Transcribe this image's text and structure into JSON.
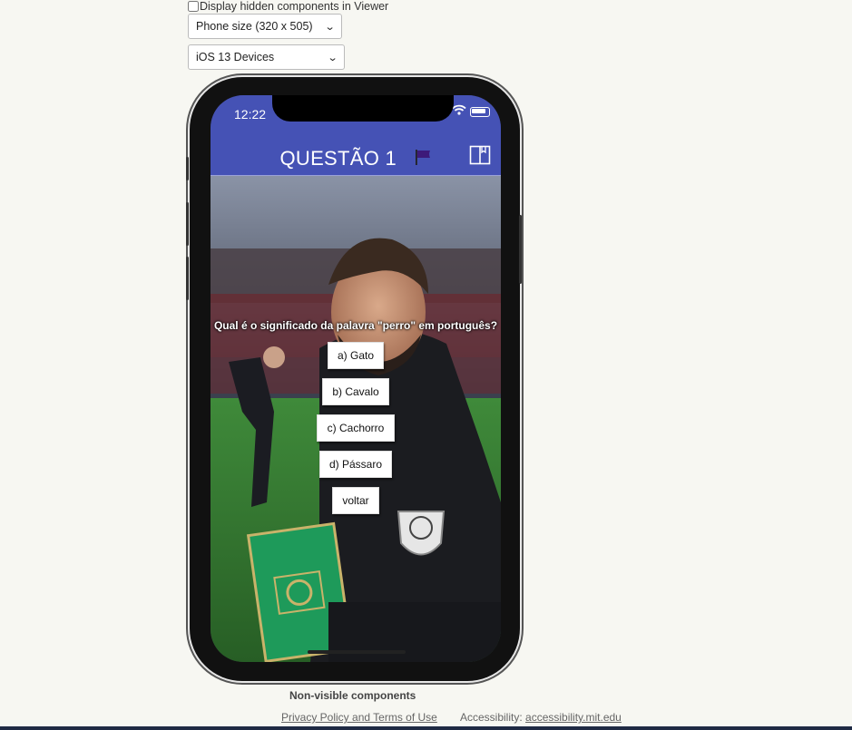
{
  "viewer": {
    "hidden_components_label": "Display hidden components in Viewer",
    "hidden_components_checked": false,
    "phone_size": "Phone size (320 x 505)",
    "device_type": "iOS 13 Devices"
  },
  "phone": {
    "status_time": "12:22",
    "title": "QUESTÃO 1",
    "flag_icon": "flag-icon",
    "book_icon": "book-icon",
    "question": "Qual é o significado da palavra \"perro\" em português?",
    "answers": [
      "a) Gato",
      "b) Cavalo",
      "c) Cachorro",
      "d) Pássaro"
    ],
    "back_label": "voltar"
  },
  "footer": {
    "non_visible": "Non-visible components",
    "privacy": "Privacy Policy and Terms of Use",
    "accessibility_prefix": "Accessibility:",
    "accessibility_link": "accessibility.mit.edu"
  },
  "colors": {
    "header": "#4552b5",
    "page_bg": "#f7f7f2"
  }
}
